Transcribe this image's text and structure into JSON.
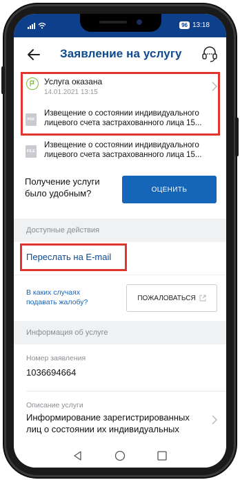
{
  "status_bar": {
    "time": "13:18",
    "battery": "96"
  },
  "header": {
    "title": "Заявление на услугу"
  },
  "service": {
    "status": "Услуга оказана",
    "date": "14.01.2021 13:15"
  },
  "files": [
    {
      "icon_label": "PDF",
      "text": "Извещение о состоянии индивидуального лицевого счета застрахованного лица 15..."
    },
    {
      "icon_label": "FILE",
      "text": "Извещение о состоянии индивидуального лицевого счета застрахованного лица 15..."
    }
  ],
  "rating": {
    "question": "Получение услуги было удобным?",
    "button": "ОЦЕНИТЬ"
  },
  "actions": {
    "section_title": "Доступные действия",
    "email_link": "Переслать на E-mail",
    "complaint_link": "В каких случаях подавать жалобу?",
    "complaint_button": "ПОЖАЛОВАТЬСЯ"
  },
  "info": {
    "section_title": "Информация об услуге",
    "number_label": "Номер заявления",
    "number_value": "1036694664",
    "description_label": "Описание услуги",
    "description_value": "Информирование зарегистрированных лиц о состоянии их индивидуальных"
  },
  "colors": {
    "brand_blue": "#0d4a8f",
    "button_blue": "#1565b8",
    "highlight_red": "#e0362c",
    "success_green": "#7fb83a"
  },
  "icons": [
    "back-arrow-icon",
    "headset-icon",
    "flag-icon",
    "chevron-right-icon",
    "file-icon",
    "external-link-icon",
    "nav-back-icon",
    "nav-home-icon",
    "nav-recents-icon"
  ]
}
